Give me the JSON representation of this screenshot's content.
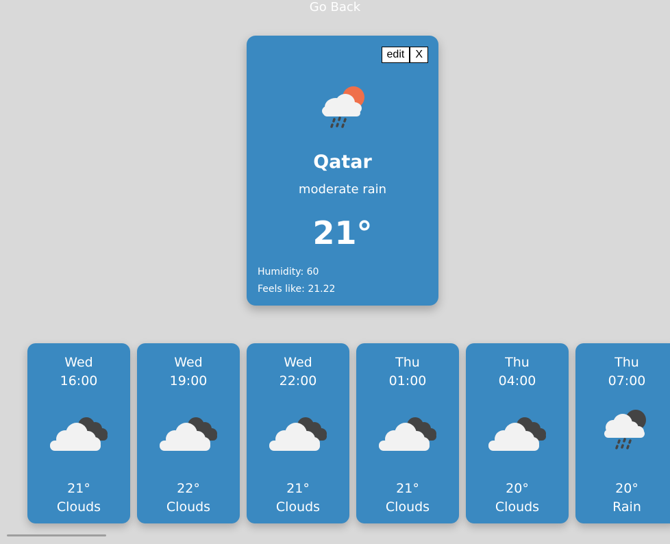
{
  "nav": {
    "go_back_label": "Go Back"
  },
  "card": {
    "edit_label": "edit",
    "close_label": "X",
    "icon": "rain-cloud-sun-icon",
    "city": "Qatar",
    "description": "moderate rain",
    "temperature": "21°",
    "humidity": "Humidity: 60",
    "feels_like": "Feels like: 21.22"
  },
  "forecast": [
    {
      "day": "Wed",
      "time": "16:00",
      "temp": "21°",
      "condition": "Clouds",
      "icon": "clouds-icon"
    },
    {
      "day": "Wed",
      "time": "19:00",
      "temp": "22°",
      "condition": "Clouds",
      "icon": "clouds-icon"
    },
    {
      "day": "Wed",
      "time": "22:00",
      "temp": "21°",
      "condition": "Clouds",
      "icon": "clouds-icon"
    },
    {
      "day": "Thu",
      "time": "01:00",
      "temp": "21°",
      "condition": "Clouds",
      "icon": "clouds-icon"
    },
    {
      "day": "Thu",
      "time": "04:00",
      "temp": "20°",
      "condition": "Clouds",
      "icon": "clouds-icon"
    },
    {
      "day": "Thu",
      "time": "07:00",
      "temp": "20°",
      "condition": "Rain",
      "icon": "rain-cloud-icon"
    }
  ],
  "colors": {
    "background": "#d9d9d9",
    "card": "#3a89c1",
    "text": "#ffffff",
    "sun": "#ef6f4a",
    "dark_cloud": "#444444",
    "light_cloud": "#f2f2f2"
  }
}
